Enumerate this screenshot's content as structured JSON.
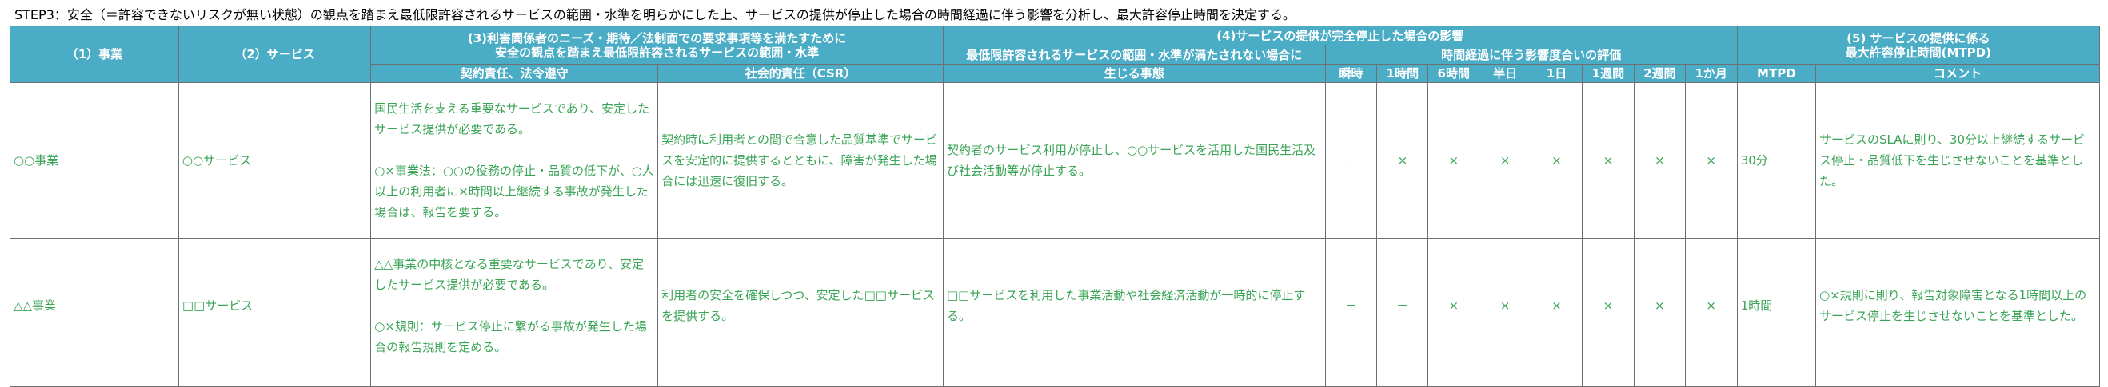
{
  "title": "STEP3：安全（＝許容できないリスクが無い状態）の観点を踏まえ最低限許容されるサービスの範囲・水準を明らかにした上、サービスの提供が停止した場合の時間経過に伴う影響を分析し、最大許容停止時間を決定する。",
  "headers": {
    "business": "（1）事業",
    "service": "（2）サービス",
    "requirements_line1": "(3)利害関係者のニーズ・期待／法制面での要求事項等を満たすために",
    "requirements_line2": "安全の観点を踏まえ最低限許容されるサービスの範囲・水準",
    "contract": "契約責任、法令遵守",
    "csr": "社会的責任（CSR）",
    "impact": "(4)サービスの提供が完全停止した場合の影響",
    "events_line1": "最低限許容されるサービスの範囲・水準が満たされない場合に",
    "events_line2": "生じる事態",
    "time_eval": "時間経過に伴う影響度合いの評価",
    "time_labels": [
      "瞬時",
      "1時間",
      "6時間",
      "半日",
      "1日",
      "1週間",
      "2週間",
      "1か月"
    ],
    "mtpd_group_line1": "(5) サービスの提供に係る",
    "mtpd_group_line2": "最大許容停止時間(MTPD)",
    "mtpd": "MTPD",
    "comment": "コメント"
  },
  "rows": [
    {
      "business": "○○事業",
      "service": "○○サービス",
      "contract_p1": "国民生活を支える重要なサービスであり、安定したサービス提供が必要である。",
      "contract_p2": "○×事業法：○○の役務の停止・品質の低下が、○人以上の利用者に×時間以上継続する事故が発生した場合は、報告を要する。",
      "csr": "契約時に利用者との間で合意した品質基準でサービスを安定的に提供するとともに、障害が発生した場合には迅速に復旧する。",
      "events": "契約者のサービス利用が停止し、○○サービスを活用した国民生活及び社会活動等が停止する。",
      "marks": [
        "－",
        "×",
        "×",
        "×",
        "×",
        "×",
        "×",
        "×"
      ],
      "mtpd": "30分",
      "comment": "サービスのSLAに則り、30分以上継続するサービス停止・品質低下を生じさせないことを基準とした。"
    },
    {
      "business": "△△事業",
      "service": "□□サービス",
      "contract_p1": "△△事業の中核となる重要なサービスであり、安定したサービス提供が必要である。",
      "contract_p2": "○×規則：サービス停止に繋がる事故が発生した場合の報告規則を定める。",
      "csr": "利用者の安全を確保しつつ、安定した□□サービスを提供する。",
      "events": "□□サービスを利用した事業活動や社会経済活動が一時的に停止する。",
      "marks": [
        "－",
        "－",
        "×",
        "×",
        "×",
        "×",
        "×",
        "×"
      ],
      "mtpd": "1時間",
      "comment": "○×規則に則り、報告対象障害となる1時間以上のサービス停止を生じさせないことを基準とした。"
    }
  ]
}
